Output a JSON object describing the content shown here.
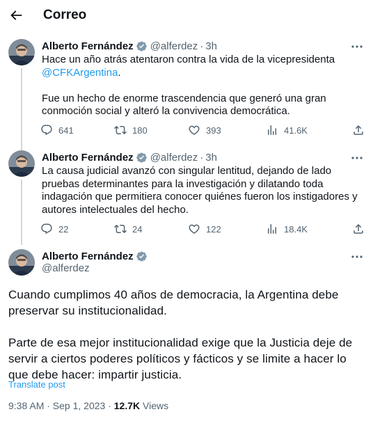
{
  "header": {
    "title": "Correo"
  },
  "tweets": [
    {
      "name": "Alberto Fernández",
      "handle": "@alferdez",
      "time": "3h",
      "paragraphs": [
        {
          "pre": "Hace un año atrás atentaron contra la vida de la vicepresidenta",
          "mention": "@CFKArgentina",
          "post": "."
        },
        {
          "pre": "Fue un hecho de enorme trascendencia que generó una gran conmoción social y alteró la convivencia democrática.",
          "mention": "",
          "post": ""
        }
      ],
      "stats": {
        "replies": "641",
        "retweets": "180",
        "likes": "393",
        "views": "41.6K"
      }
    },
    {
      "name": "Alberto Fernández",
      "handle": "@alferdez",
      "time": "3h",
      "paragraphs": [
        {
          "pre": "La causa judicial avanzó con singular lentitud, dejando de lado pruebas determinantes para la investigación y dilatando toda indagación que permitiera conocer quiénes fueron los instigadores y autores intelectuales del hecho.",
          "mention": "",
          "post": ""
        }
      ],
      "stats": {
        "replies": "22",
        "retweets": "24",
        "likes": "122",
        "views": "18.4K"
      }
    }
  ],
  "main_tweet": {
    "name": "Alberto Fernández",
    "handle": "@alferdez",
    "paragraphs": [
      "Cuando cumplimos 40 años de democracia, la Argentina debe preservar su institucionalidad.",
      "Parte de esa mejor institucionalidad exige que la Justicia deje de servir a ciertos poderes políticos y fácticos y se limite a hacer lo que debe hacer: impartir justicia."
    ],
    "translate_label": "Translate post",
    "timestamp": "9:38 AM · Sep 1, 2023 · ",
    "views_count": "12.7K",
    "views_label": " Views"
  },
  "colors": {
    "accent": "#1d9bf0",
    "secondary_text": "#536471",
    "verified": "#829aab"
  },
  "icons": [
    "back-arrow-icon",
    "verified-badge-icon",
    "more-icon",
    "reply-icon",
    "retweet-icon",
    "like-icon",
    "views-icon",
    "share-icon"
  ]
}
